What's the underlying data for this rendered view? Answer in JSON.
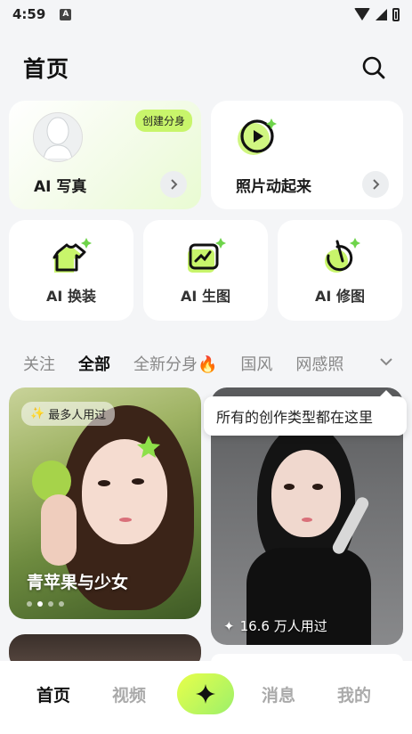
{
  "status": {
    "time": "4:59",
    "notif_badge": "A"
  },
  "header": {
    "title": "首页"
  },
  "features": {
    "ai_photo": {
      "title": "AI 写真",
      "badge": "创建分身"
    },
    "animate": {
      "title": "照片动起来"
    },
    "outfit": {
      "title": "AI 换装"
    },
    "generate": {
      "title": "AI 生图"
    },
    "retouch": {
      "title": "AI 修图"
    }
  },
  "tabs": [
    {
      "label": "关注"
    },
    {
      "label": "全部"
    },
    {
      "label": "全新分身🔥"
    },
    {
      "label": "国风"
    },
    {
      "label": "网感照"
    }
  ],
  "tooltip": {
    "text": "所有的创作类型都在这里"
  },
  "feed": [
    {
      "badge": "最多人用过",
      "title": "青苹果与少女",
      "page_dots": 4,
      "active_dot": 2
    },
    {
      "used_count": "16.6 万人用过"
    }
  ],
  "bottom_nav": {
    "home": "首页",
    "video": "视频",
    "messages": "消息",
    "me": "我的"
  },
  "colors": {
    "accent": "#c8f56b",
    "accent_gradient_start": "#e8ff4a",
    "accent_gradient_end": "#9cf06a"
  }
}
